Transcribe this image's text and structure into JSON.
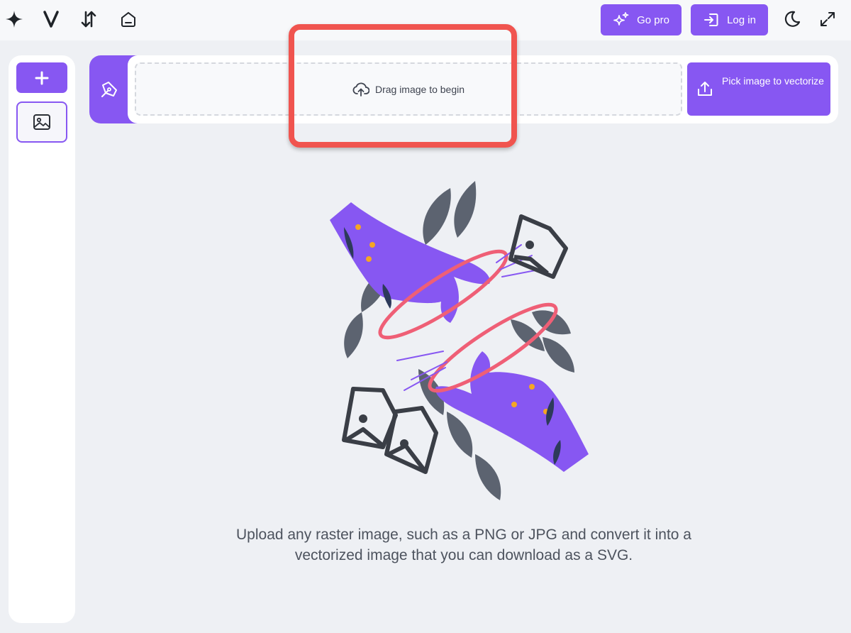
{
  "topbar": {
    "icons": [
      "sparkle-icon",
      "v-logo-icon",
      "sort-arrows-icon",
      "home-icon"
    ],
    "go_pro_label": "Go pro",
    "login_label": "Log in",
    "right_icons": [
      "moon-icon",
      "expand-icon"
    ]
  },
  "sidebar": {
    "add_icon": "plus-icon",
    "image_icon": "image-icon"
  },
  "upload": {
    "tool_icon": "pen-tool-icon",
    "drop_text": "Drag image to begin",
    "pick_label": "Pick image to vectorize"
  },
  "caption": "Upload any raster image, such as a PNG or JPG and convert it into a vectorized image that you can download as a SVG.",
  "colors": {
    "accent": "#8757f2",
    "highlight": "#f0544f",
    "background": "#eef0f4"
  }
}
